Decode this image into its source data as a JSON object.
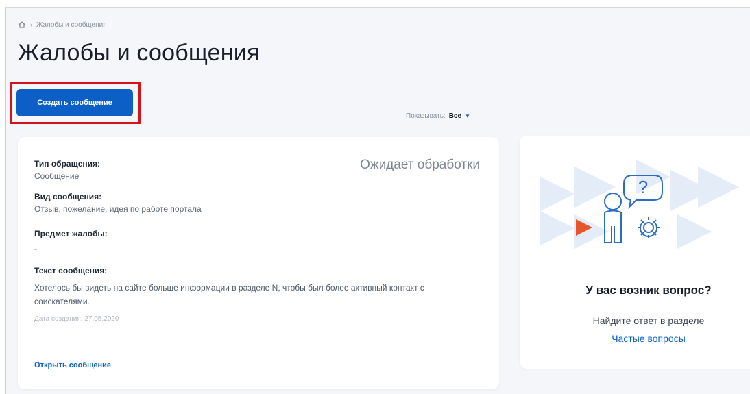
{
  "breadcrumb": {
    "home_icon": "home-icon",
    "separator": "›",
    "current": "Жалобы и сообщения"
  },
  "page": {
    "title": "Жалобы и сообщения",
    "create_button": "Создать сообщение"
  },
  "filter": {
    "label": "Показывать:",
    "value": "Все",
    "caret_icon": "chevron-down-icon"
  },
  "message": {
    "status": "Ожидает обработки",
    "type_label": "Тип обращения:",
    "type_value": "Сообщение",
    "kind_label": "Вид сообщения:",
    "kind_value": "Отзыв, пожелание, идея по работе портала",
    "subject_label": "Предмет жалобы:",
    "subject_value": "-",
    "text_label": "Текст сообщения:",
    "text_value": "Хотелось бы видеть на сайте больше информации в разделе N, чтобы был более активный контакт с соискателями.",
    "date": "Дата создания: 27.05.2020",
    "open_link": "Открыть сообщение"
  },
  "help": {
    "illustration_icon": "question-person-gear-icon",
    "title": "У вас возник вопрос?",
    "text": "Найдите ответ в разделе",
    "link": "Частые вопросы"
  },
  "colors": {
    "accent": "#0c5fc6",
    "highlight": "#d3141c",
    "illustration_orange": "#e8542c",
    "illustration_light_blue": "#e3ecf7"
  }
}
